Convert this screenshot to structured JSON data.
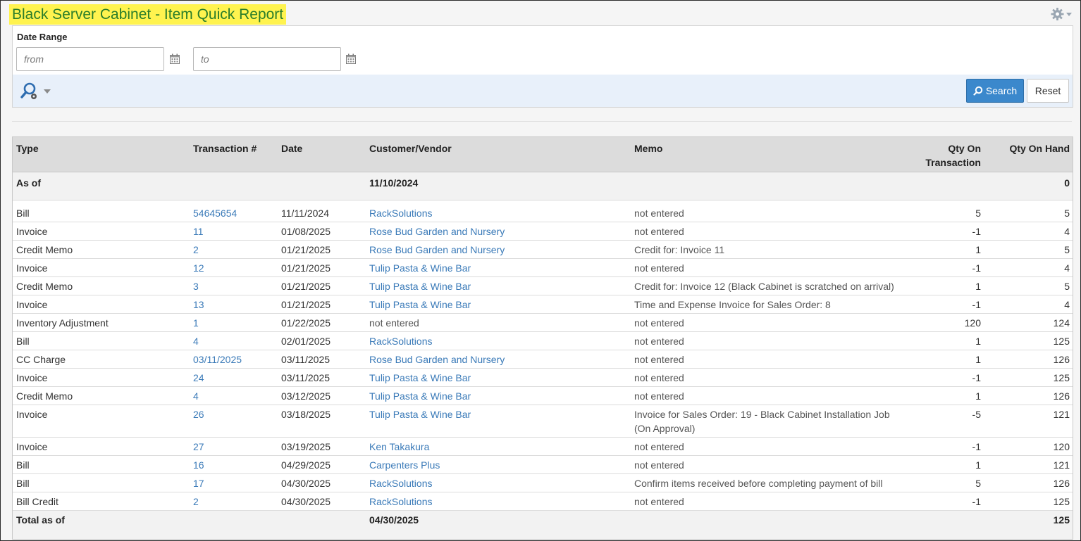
{
  "page": {
    "title": "Black Server Cabinet - Item Quick Report"
  },
  "filter": {
    "date_range_label": "Date Range",
    "from_placeholder": "from",
    "to_placeholder": "to",
    "search_label": "Search",
    "reset_label": "Reset"
  },
  "table": {
    "headers": {
      "type": "Type",
      "transaction": "Transaction #",
      "date": "Date",
      "customer": "Customer/Vendor",
      "memo": "Memo",
      "qty_line1": "Qty On",
      "qty_line2": "Transaction",
      "on_hand": "Qty On Hand"
    },
    "as_of": {
      "label": "As of",
      "date": "11/10/2024",
      "on_hand": "0"
    },
    "rows": [
      {
        "type": "Bill",
        "num": "54645654",
        "date": "11/11/2024",
        "customer": "RackSolutions",
        "customer_link": true,
        "memo": "not entered",
        "qty": "5",
        "on_hand": "5"
      },
      {
        "type": "Invoice",
        "num": "11",
        "date": "01/08/2025",
        "customer": "Rose Bud Garden and Nursery",
        "customer_link": true,
        "memo": "not entered",
        "qty": "-1",
        "on_hand": "4"
      },
      {
        "type": "Credit Memo",
        "num": "2",
        "date": "01/21/2025",
        "customer": "Rose Bud Garden and Nursery",
        "customer_link": true,
        "memo": "Credit for: Invoice 11",
        "qty": "1",
        "on_hand": "5"
      },
      {
        "type": "Invoice",
        "num": "12",
        "date": "01/21/2025",
        "customer": "Tulip Pasta & Wine Bar",
        "customer_link": true,
        "memo": "not entered",
        "qty": "-1",
        "on_hand": "4"
      },
      {
        "type": "Credit Memo",
        "num": "3",
        "date": "01/21/2025",
        "customer": "Tulip Pasta & Wine Bar",
        "customer_link": true,
        "memo": "Credit for: Invoice 12 (Black Cabinet is scratched on arrival)",
        "qty": "1",
        "on_hand": "5"
      },
      {
        "type": "Invoice",
        "num": "13",
        "date": "01/21/2025",
        "customer": "Tulip Pasta & Wine Bar",
        "customer_link": true,
        "memo": "Time and Expense Invoice for Sales Order: 8",
        "qty": "-1",
        "on_hand": "4"
      },
      {
        "type": "Inventory Adjustment",
        "num": "1",
        "date": "01/22/2025",
        "customer": "not entered",
        "customer_link": false,
        "memo": "not entered",
        "qty": "120",
        "on_hand": "124"
      },
      {
        "type": "Bill",
        "num": "4",
        "date": "02/01/2025",
        "customer": "RackSolutions",
        "customer_link": true,
        "memo": "not entered",
        "qty": "1",
        "on_hand": "125"
      },
      {
        "type": "CC Charge",
        "num": "03/11/2025",
        "date": "03/11/2025",
        "customer": "Rose Bud Garden and Nursery",
        "customer_link": true,
        "memo": "not entered",
        "qty": "1",
        "on_hand": "126"
      },
      {
        "type": "Invoice",
        "num": "24",
        "date": "03/11/2025",
        "customer": "Tulip Pasta & Wine Bar",
        "customer_link": true,
        "memo": "not entered",
        "qty": "-1",
        "on_hand": "125"
      },
      {
        "type": "Credit Memo",
        "num": "4",
        "date": "03/12/2025",
        "customer": "Tulip Pasta & Wine Bar",
        "customer_link": true,
        "memo": "not entered",
        "qty": "1",
        "on_hand": "126"
      },
      {
        "type": "Invoice",
        "num": "26",
        "date": "03/18/2025",
        "customer": "Tulip Pasta & Wine Bar",
        "customer_link": true,
        "memo": "Invoice for Sales Order: 19 - Black Cabinet Installation Job (On Approval)",
        "qty": "-5",
        "on_hand": "121",
        "tall": true
      },
      {
        "type": "Invoice",
        "num": "27",
        "date": "03/19/2025",
        "customer": "Ken Takakura",
        "customer_link": true,
        "memo": "not entered",
        "qty": "-1",
        "on_hand": "120"
      },
      {
        "type": "Bill",
        "num": "16",
        "date": "04/29/2025",
        "customer": "Carpenters Plus",
        "customer_link": true,
        "memo": "not entered",
        "qty": "1",
        "on_hand": "121"
      },
      {
        "type": "Bill",
        "num": "17",
        "date": "04/30/2025",
        "customer": "RackSolutions",
        "customer_link": true,
        "memo": "Confirm items received before completing payment of bill",
        "qty": "5",
        "on_hand": "126"
      },
      {
        "type": "Bill Credit",
        "num": "2",
        "date": "04/30/2025",
        "customer": "RackSolutions",
        "customer_link": true,
        "memo": "not entered",
        "qty": "-1",
        "on_hand": "125"
      }
    ],
    "total": {
      "label": "Total as of",
      "date": "04/30/2025",
      "on_hand": "125"
    }
  }
}
